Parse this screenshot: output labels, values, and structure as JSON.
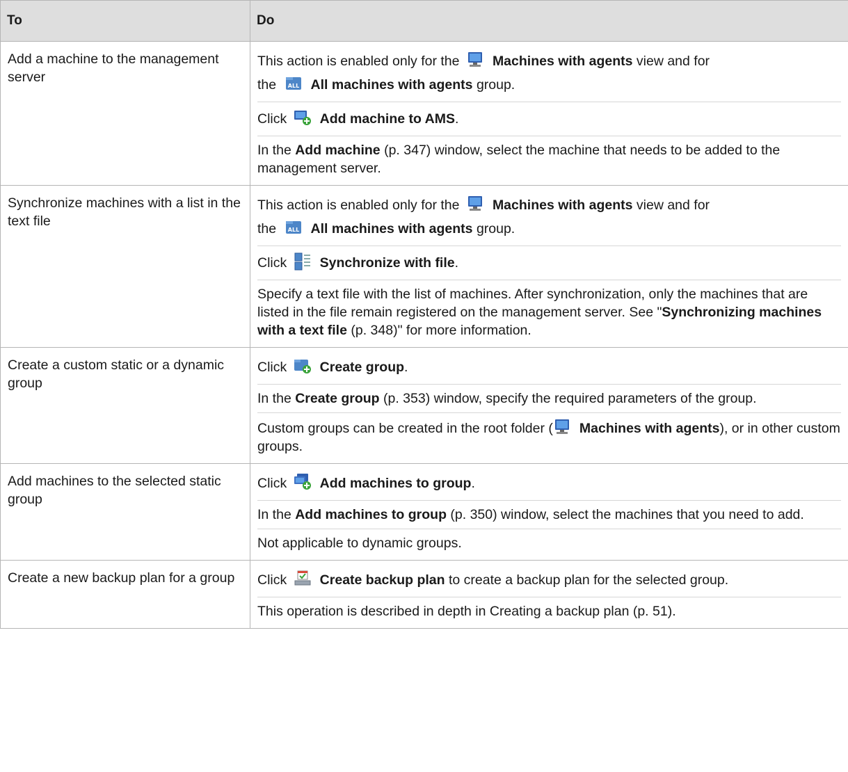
{
  "header": {
    "col_to": "To",
    "col_do": "Do"
  },
  "rows": [
    {
      "to": "Add a machine to the management server",
      "enabled_prefix": "This action is enabled only for the",
      "enabled_view": "Machines with agents",
      "enabled_mid": "view and for",
      "enabled_the": "the",
      "enabled_group": "All machines with agents",
      "enabled_suffix": "group.",
      "click": "Click",
      "action": "Add machine to AMS",
      "action_suffix": ".",
      "p3_prefix": "In the",
      "p3_bold": "Add machine",
      "p3_rest": "(p. 347) window, select the machine that needs to be added to the management server."
    },
    {
      "to": "Synchronize machines with a list in the text file",
      "enabled_prefix": "This action is enabled only for the",
      "enabled_view": "Machines with agents",
      "enabled_mid": "view and for",
      "enabled_the": "the",
      "enabled_group": "All machines with agents",
      "enabled_suffix": "group.",
      "click": "Click",
      "action": "Synchronize with file",
      "action_suffix": ".",
      "p3_text": "Specify a text file with the list of machines. After synchronization, only the machines that are listed in the file remain registered on the management server. See \"",
      "p3_bold": "Synchronizing machines with a text file",
      "p3_rest": " (p. 348)\" for more information."
    },
    {
      "to": "Create a custom static or a dynamic group",
      "click": "Click",
      "action": "Create group",
      "action_suffix": ".",
      "p2_prefix": "In the",
      "p2_bold": "Create group",
      "p2_rest": "(p. 353) window, specify the required parameters of the group.",
      "p3_prefix": "Custom groups can be created in the root folder (",
      "p3_bold": "Machines with agents",
      "p3_rest": "), or in other custom groups."
    },
    {
      "to": "Add machines to the selected static group",
      "click": "Click",
      "action": "Add machines to group",
      "action_suffix": ".",
      "p2_prefix": "In the",
      "p2_bold": "Add machines to group",
      "p2_rest": "(p. 350) window, select the machines that you need to add.",
      "p3": "Not applicable to dynamic groups."
    },
    {
      "to": "Create a new backup plan for a group",
      "click": "Click",
      "action": "Create backup plan",
      "action_suffix": "to create a backup plan for the selected group.",
      "p2": "This operation is described in depth in Creating a backup plan (p. 51)."
    }
  ],
  "icons": {
    "machine": "computer-icon",
    "all_group": "all-machines-group-icon",
    "add_machine": "add-machine-icon",
    "sync": "synchronize-file-icon",
    "create_group": "create-group-icon",
    "add_machines": "add-machines-to-group-icon",
    "backup_plan": "backup-plan-icon"
  }
}
